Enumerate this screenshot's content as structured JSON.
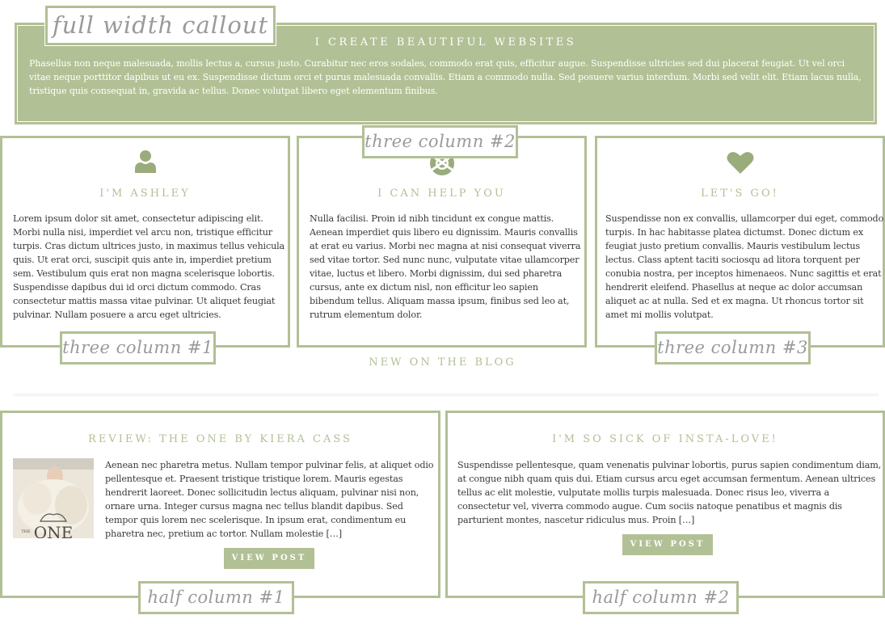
{
  "callout": {
    "label": "full width callout",
    "title": "I CREATE BEAUTIFUL WEBSITES",
    "text": "Phasellus non neque malesuada, mollis lectus a, cursus justo. Curabitur nec eros sodales, commodo erat quis, efficitur augue. Suspendisse ultricies sed dui placerat feugiat. Ut vel orci vitae neque porttitor dapibus ut eu ex. Suspendisse dictum orci et purus malesuada convallis. Etiam a commodo nulla. Sed posuere varius interdum. Morbi sed velit elit. Etiam lacus nulla, tristique quis consequat in, gravida ac tellus. Donec volutpat libero eget elementum finibus."
  },
  "columns": [
    {
      "label": "three column #1",
      "icon": "user-icon",
      "title": "I'M ASHLEY",
      "text": "Lorem ipsum dolor sit amet, consectetur adipiscing elit. Morbi nulla nisi, imperdiet vel arcu non, tristique efficitur turpis. Cras dictum ultrices justo, in maximus tellus vehicula quis. Ut erat orci, suscipit quis ante in, imperdiet pretium sem. Vestibulum quis erat non magna scelerisque lobortis. Suspendisse dapibus dui id orci dictum commodo. Cras consectetur mattis massa vitae pulvinar. Ut aliquet feugiat pulvinar. Nullam posuere a arcu eget ultricies."
    },
    {
      "label": "three column #2",
      "icon": "life-ring-icon",
      "title": "I CAN HELP YOU",
      "text": "Nulla facilisi. Proin id nibh tincidunt ex congue mattis. Aenean imperdiet quis libero eu dignissim. Mauris convallis at erat eu varius. Morbi nec magna at nisi consequat viverra sed vitae tortor. Sed nunc nunc, vulputate vitae ullamcorper vitae, luctus et libero. Morbi dignissim, dui sed pharetra cursus, ante ex dictum nisl, non efficitur leo sapien bibendum tellus. Aliquam massa ipsum, finibus sed leo at, rutrum elementum dolor."
    },
    {
      "label": "three column #3",
      "icon": "heart-icon",
      "title": "LET'S GO!",
      "text": "Suspendisse non ex convallis, ullamcorper dui eget, commodo turpis. In hac habitasse platea dictumst. Donec dictum ex feugiat justo pretium convallis. Mauris vestibulum lectus lectus. Class aptent taciti sociosqu ad litora torquent per conubia nostra, per inceptos himenaeos. Nunc sagittis et erat hendrerit eleifend. Phasellus at neque ac dolor accumsan aliquet ac at nulla. Sed et ex magna. Ut rhoncus tortor sit amet mi mollis volutpat."
    }
  ],
  "blog": {
    "heading": "NEW ON THE BLOG",
    "posts": [
      {
        "label": "half column #1",
        "title": "REVIEW: THE ONE BY KIERA CASS",
        "thumb_text": "ONE",
        "thumb_small": "THE",
        "text": "Aenean nec pharetra metus. Nullam tempor pulvinar felis, at aliquet odio pellentesque et. Praesent tristique tristique lorem. Mauris egestas hendrerit laoreet. Donec sollicitudin lectus aliquam, pulvinar nisi non, ornare urna. Integer cursus magna nec tellus blandit dapibus. Sed tempor quis lorem nec scelerisque. In ipsum erat, condimentum eu pharetra nec, pretium ac tortor. Nullam molestie […]",
        "button": "VIEW POST"
      },
      {
        "label": "half column #2",
        "title": "I'M SO SICK OF INSTA-LOVE!",
        "text": "Suspendisse pellentesque, quam venenatis pulvinar lobortis, purus sapien condimentum diam, at congue nibh quam quis dui. Etiam cursus arcu eget accumsan fermentum. Aenean ultrices tellus ac elit molestie, vulputate mollis turpis malesuada. Donec risus leo, viverra a consectetur vel, viverra commodo augue. Cum sociis natoque penatibus et magnis dis parturient montes, nascetur ridiculus mus. Proin […]",
        "button": "VIEW POST"
      }
    ]
  },
  "colors": {
    "accent": "#b2c095",
    "icon": "#9aab7c",
    "label_text": "#9a9a9a",
    "body_text": "#3a3a3a"
  }
}
